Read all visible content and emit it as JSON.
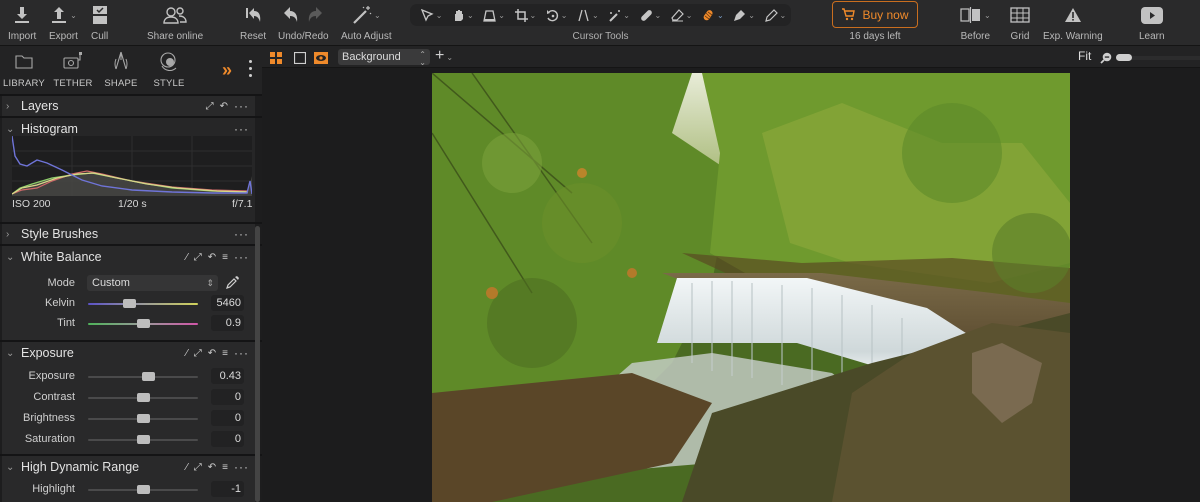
{
  "toolbar": {
    "import": "Import",
    "export": "Export",
    "cull": "Cull",
    "share": "Share online",
    "reset": "Reset",
    "undo_redo": "Undo/Redo",
    "auto_adjust": "Auto Adjust",
    "cursor_tools_label": "Cursor Tools",
    "cursor_tools": [
      "select-cursor-icon",
      "pan-hand-icon",
      "keystone-icon",
      "crop-icon",
      "rotate-icon",
      "straighten-icon",
      "magic-brush-icon",
      "healing-icon",
      "eraser-icon",
      "draw-mask-icon",
      "picker-icon",
      "pencil-icon"
    ],
    "active_cursor_tool": "draw-mask-icon",
    "buy_now": "Buy now",
    "trial_left": "16 days left",
    "before": "Before",
    "grid": "Grid",
    "exp_warning": "Exp. Warning",
    "learn": "Learn",
    "accent": "#ef8a2b"
  },
  "left_panel": {
    "tabs": [
      "LIBRARY",
      "TETHER",
      "SHAPE",
      "STYLE"
    ],
    "sections": {
      "layers": "Layers",
      "histogram": "Histogram",
      "style_brushes": "Style Brushes",
      "white_balance": "White Balance",
      "exposure": "Exposure",
      "hdr": "High Dynamic Range"
    },
    "histogram": {
      "iso": "ISO 200",
      "shutter": "1/20 s",
      "aperture": "f/7.1"
    },
    "white_balance": {
      "mode_label": "Mode",
      "mode_value": "Custom",
      "kelvin_label": "Kelvin",
      "kelvin_value": "5460",
      "kelvin_pos": 0.38,
      "tint_label": "Tint",
      "tint_value": "0.9",
      "tint_pos": 0.5
    },
    "exposure": {
      "rows": [
        {
          "label": "Exposure",
          "value": "0.43",
          "pos": 0.55
        },
        {
          "label": "Contrast",
          "value": "0",
          "pos": 0.5
        },
        {
          "label": "Brightness",
          "value": "0",
          "pos": 0.5
        },
        {
          "label": "Saturation",
          "value": "0",
          "pos": 0.5
        }
      ]
    },
    "hdr": {
      "rows": [
        {
          "label": "Highlight",
          "value": "-1",
          "pos": 0.5
        }
      ]
    }
  },
  "viewer": {
    "layer": "Background",
    "zoom": "Fit"
  }
}
